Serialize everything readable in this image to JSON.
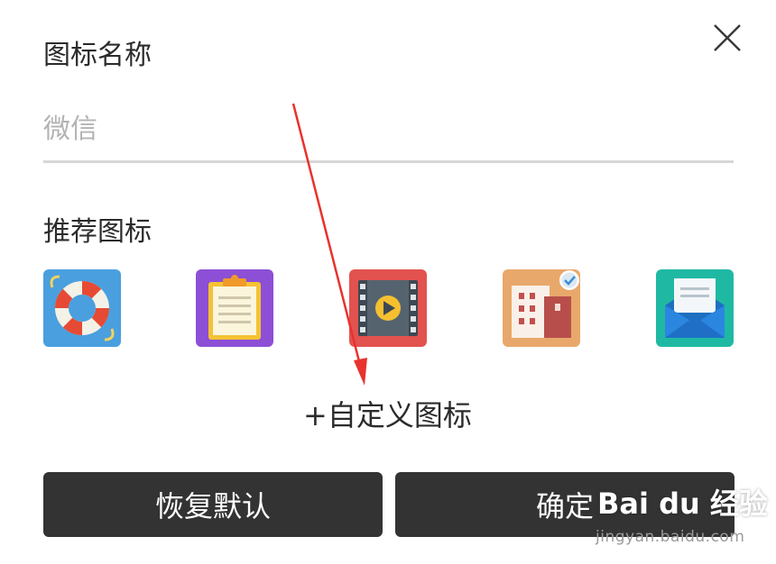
{
  "dialog": {
    "title": "图标名称",
    "close_icon": "close-icon",
    "name_input": {
      "value": "",
      "placeholder": "微信"
    },
    "recommended_title": "推荐图标",
    "recommended_icons": [
      "lifebuoy-icon",
      "clipboard-icon",
      "video-icon",
      "building-icon",
      "mail-icon"
    ],
    "custom_icon_label": "+自定义图标",
    "restore_default_label": "恢复默认",
    "confirm_label": "确定"
  },
  "watermark": {
    "logo": "Bai du 经验",
    "url": "jingyan.baidu.com"
  },
  "colors": {
    "button_bg": "#333333",
    "arrow": "#e8322d",
    "underline": "#d7d7d7"
  }
}
